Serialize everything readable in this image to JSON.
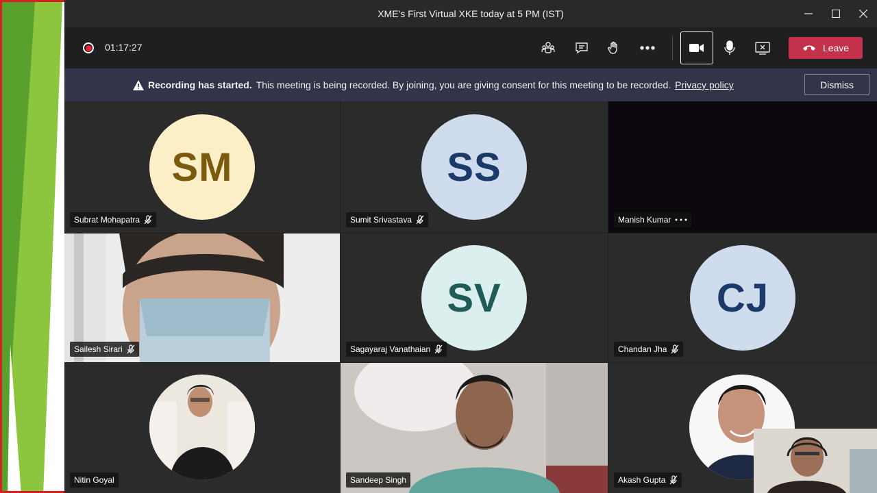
{
  "window": {
    "title": "XME's First Virtual XKE today at 5 PM (IST)"
  },
  "toolbar": {
    "timer": "01:17:27",
    "leave_label": "Leave"
  },
  "banner": {
    "bold_text": "Recording has started.",
    "message": "This meeting is being recorded. By joining, you are giving consent for this meeting to be recorded.",
    "link": "Privacy policy",
    "dismiss_label": "Dismiss"
  },
  "participants": [
    {
      "name": "Subrat Mohapatra",
      "initials": "SM",
      "muted": true
    },
    {
      "name": "Sumit Srivastava",
      "initials": "SS",
      "muted": true
    },
    {
      "name": "Manish Kumar",
      "initials": "",
      "muted": false
    },
    {
      "name": "Sailesh Sirari",
      "initials": "",
      "muted": true
    },
    {
      "name": "Sagayaraj Vanathaian",
      "initials": "SV",
      "muted": true
    },
    {
      "name": "Chandan Jha",
      "initials": "CJ",
      "muted": true
    },
    {
      "name": "Nitin Goyal",
      "initials": "",
      "muted": false
    },
    {
      "name": "Sandeep Singh",
      "initials": "",
      "muted": false
    },
    {
      "name": "Akash Gupta",
      "initials": "",
      "muted": true
    }
  ],
  "colors": {
    "leave": "#c4314b",
    "banner": "#33344a",
    "recording": "#e0263b"
  }
}
